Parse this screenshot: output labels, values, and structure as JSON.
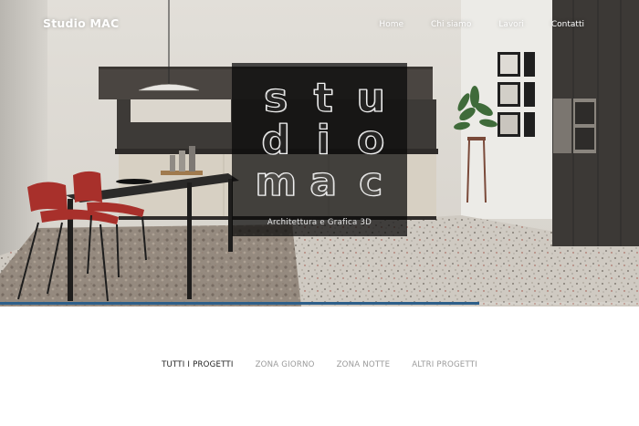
{
  "header": {
    "brand": "Studio MAC",
    "nav": [
      {
        "label": "Home"
      },
      {
        "label": "Chi siamo"
      },
      {
        "label": "Lavori"
      },
      {
        "label": "Contatti"
      }
    ]
  },
  "hero": {
    "logo": {
      "letters": [
        "S",
        "T",
        "U",
        "D",
        "I",
        "O",
        "M",
        "A",
        "C"
      ],
      "tagline": "Architettura e Grafica 3D"
    },
    "progress": 0.75
  },
  "filters": {
    "tabs": [
      {
        "label": "TUTTI I PROGETTI",
        "active": true
      },
      {
        "label": "ZONA GIORNO",
        "active": false
      },
      {
        "label": "ZONA NOTTE",
        "active": false
      },
      {
        "label": "ALTRI PROGETTI",
        "active": false
      }
    ]
  },
  "colors": {
    "accent": "#2d5f8a",
    "tab_active": "#222222",
    "tab_inactive": "#9a9a9a"
  }
}
